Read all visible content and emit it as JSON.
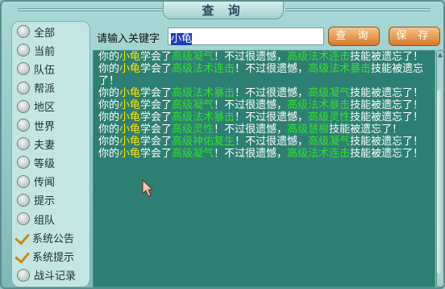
{
  "window": {
    "title": "查 询"
  },
  "sidebar": {
    "items": [
      {
        "label": "全部",
        "type": "radio"
      },
      {
        "label": "当前",
        "type": "radio"
      },
      {
        "label": "队伍",
        "type": "radio"
      },
      {
        "label": "帮派",
        "type": "radio"
      },
      {
        "label": "地区",
        "type": "radio"
      },
      {
        "label": "世界",
        "type": "radio"
      },
      {
        "label": "夫妻",
        "type": "radio"
      },
      {
        "label": "等级",
        "type": "radio"
      },
      {
        "label": "传闻",
        "type": "radio"
      },
      {
        "label": "提示",
        "type": "radio"
      },
      {
        "label": "组队",
        "type": "radio"
      },
      {
        "label": "系统公告",
        "type": "check"
      },
      {
        "label": "系统提示",
        "type": "check"
      },
      {
        "label": "战斗记录",
        "type": "radio"
      }
    ]
  },
  "search": {
    "label": "请输入关键字",
    "value": "小龟"
  },
  "toolbar": {
    "query_label": "查 询",
    "save_label": "保 存"
  },
  "log": {
    "entries": [
      {
        "p1": "你的",
        "pet": "小龟",
        "p2": "学会了",
        "skill1": "高级凝气",
        "p3": "！不过很遗憾，",
        "skill2": "高级法术连击",
        "p4": "技能被遗忘了！"
      },
      {
        "p1": "你的",
        "pet": "小龟",
        "p2": "学会了",
        "skill1": "高级法术连击",
        "p3": "！不过很遗憾，",
        "skill2": "高级法术暴击",
        "p4": "技能被遗忘了！"
      },
      {
        "p1": "你的",
        "pet": "小龟",
        "p2": "学会了",
        "skill1": "高级法术暴击",
        "p3": "！不过很遗憾，",
        "skill2": "高级凝气",
        "p4": "技能被遗忘了！"
      },
      {
        "p1": "你的",
        "pet": "小龟",
        "p2": "学会了",
        "skill1": "高级凝气",
        "p3": "！不过很遗憾，",
        "skill2": "高级法术暴击",
        "p4": "技能被遗忘了！"
      },
      {
        "p1": "你的",
        "pet": "小龟",
        "p2": "学会了",
        "skill1": "高级法术暴击",
        "p3": "！不过很遗憾，",
        "skill2": "高级灵性",
        "p4": "技能被遗忘了！"
      },
      {
        "p1": "你的",
        "pet": "小龟",
        "p2": "学会了",
        "skill1": "高级灵性",
        "p3": "！不过很遗憾，",
        "skill2": "高级慧根",
        "p4": "技能被遗忘了！"
      },
      {
        "p1": "你的",
        "pet": "小龟",
        "p2": "学会了",
        "skill1": "高级神佑复生",
        "p3": "！不过很遗憾，",
        "skill2": "高级凝气",
        "p4": "技能被遗忘了！"
      },
      {
        "p1": "你的",
        "pet": "小龟",
        "p2": "学会了",
        "skill1": "高级凝气",
        "p3": "！不过很遗憾，",
        "skill2": "高级法术连击",
        "p4": "技能被遗忘了！"
      }
    ]
  }
}
